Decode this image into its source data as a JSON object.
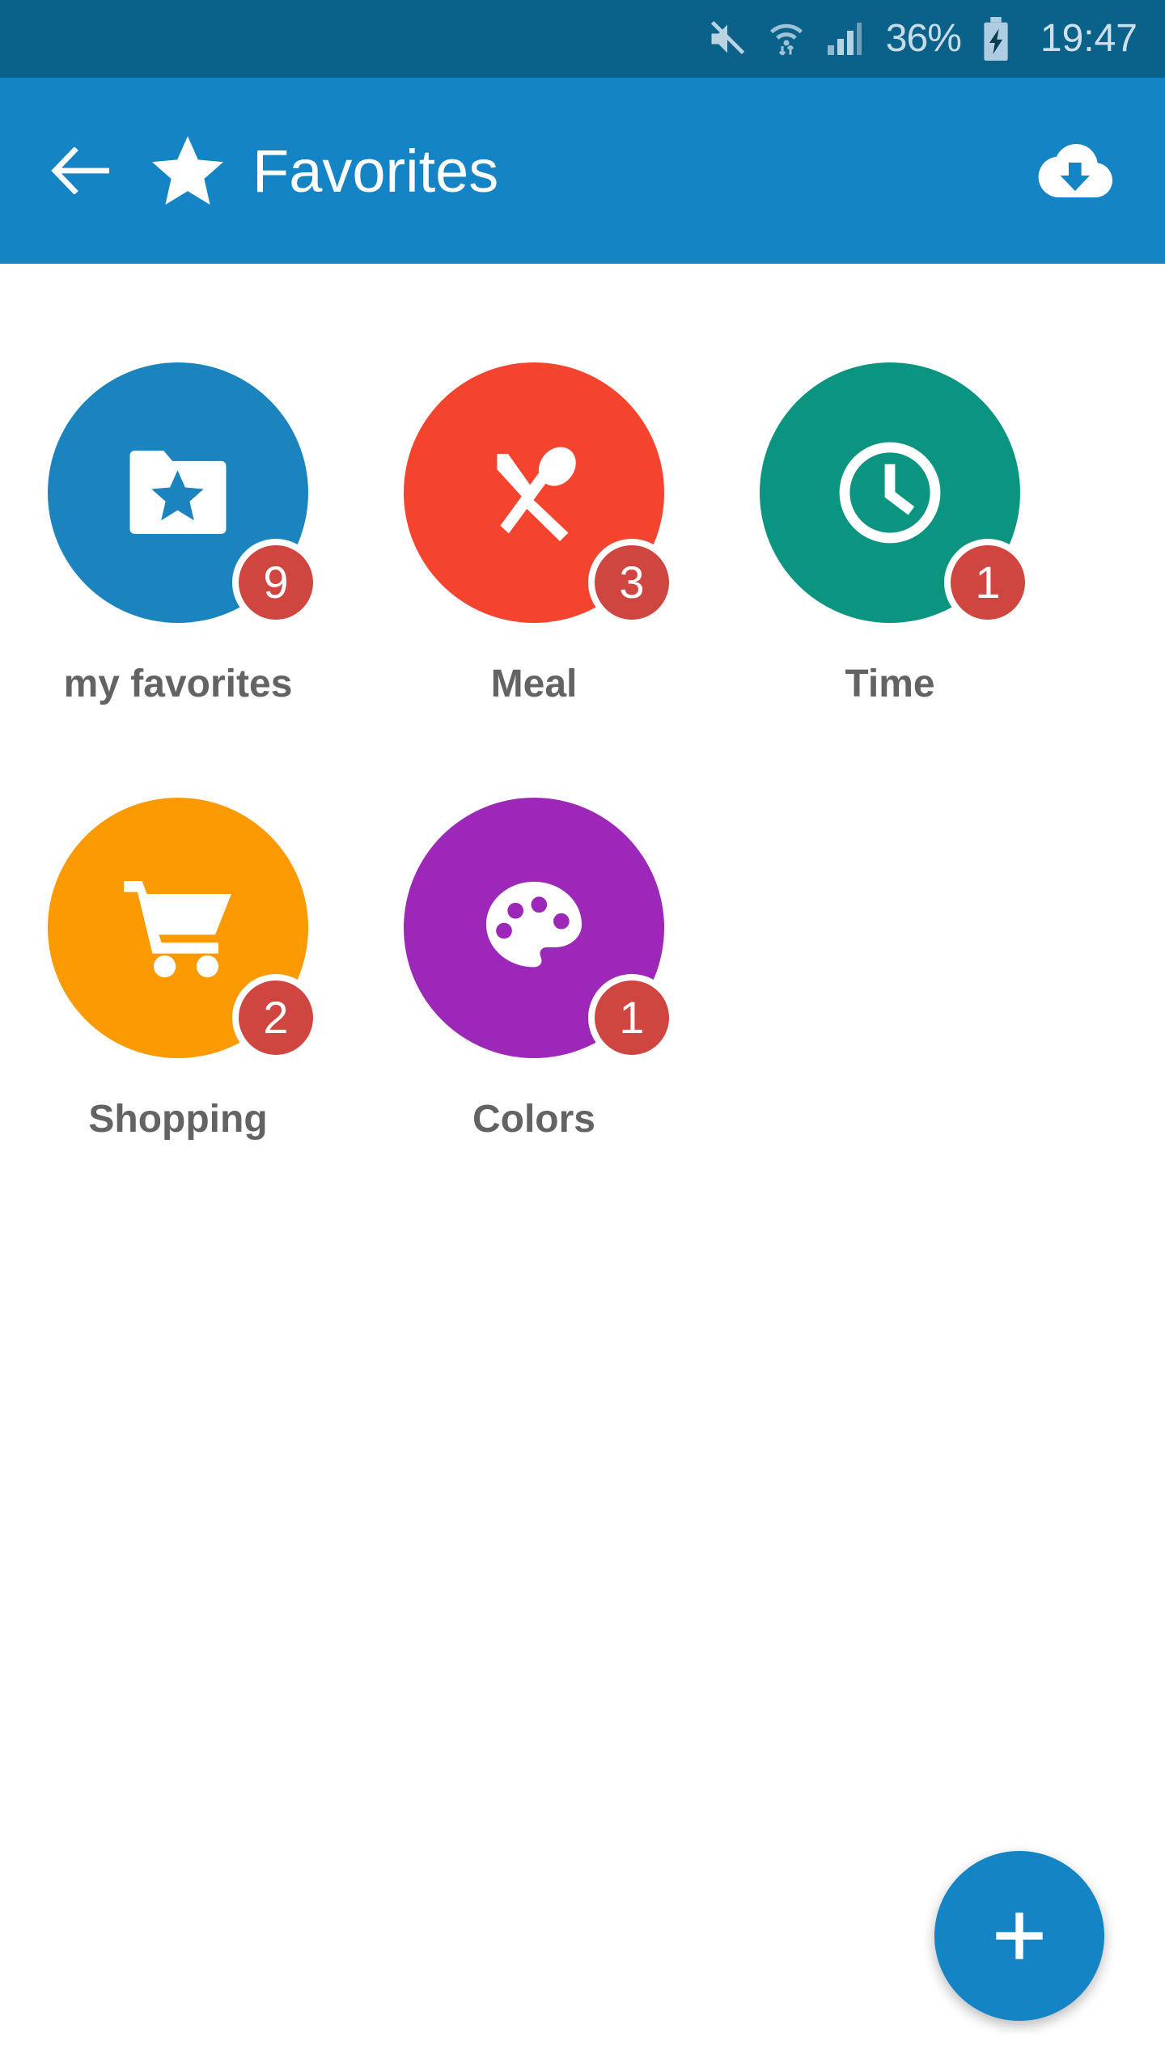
{
  "status_bar": {
    "background": "#0a6189",
    "mute_icon": "volume-mute-icon",
    "wifi_icon": "wifi-transfer-icon",
    "signal_icon": "cellular-signal-icon",
    "battery_percent": "36%",
    "battery_icon": "battery-charging-icon",
    "time": "19:47"
  },
  "app_bar": {
    "background": "#1484c4",
    "back_icon": "arrow-left-icon",
    "star_icon": "star-icon",
    "title": "Favorites",
    "action_icon": "cloud-download-icon"
  },
  "tiles": [
    {
      "label": "my favorites",
      "badge": "9",
      "color": "#1b84bf",
      "icon": "folder-star-icon"
    },
    {
      "label": "Meal",
      "badge": "3",
      "color": "#f4442e",
      "icon": "cutlery-icon"
    },
    {
      "label": "Time",
      "badge": "1",
      "color": "#0b9480",
      "icon": "clock-icon"
    },
    {
      "label": "Shopping",
      "badge": "2",
      "color": "#fb9a00",
      "icon": "shopping-cart-icon"
    },
    {
      "label": "Colors",
      "badge": "1",
      "color": "#9c27b8",
      "icon": "palette-icon"
    }
  ],
  "fab": {
    "icon": "plus-icon",
    "color": "#1484c4"
  },
  "theme": {
    "badge_color": "#cf4540",
    "label_color": "#636363",
    "page_background": "#ffffff"
  }
}
